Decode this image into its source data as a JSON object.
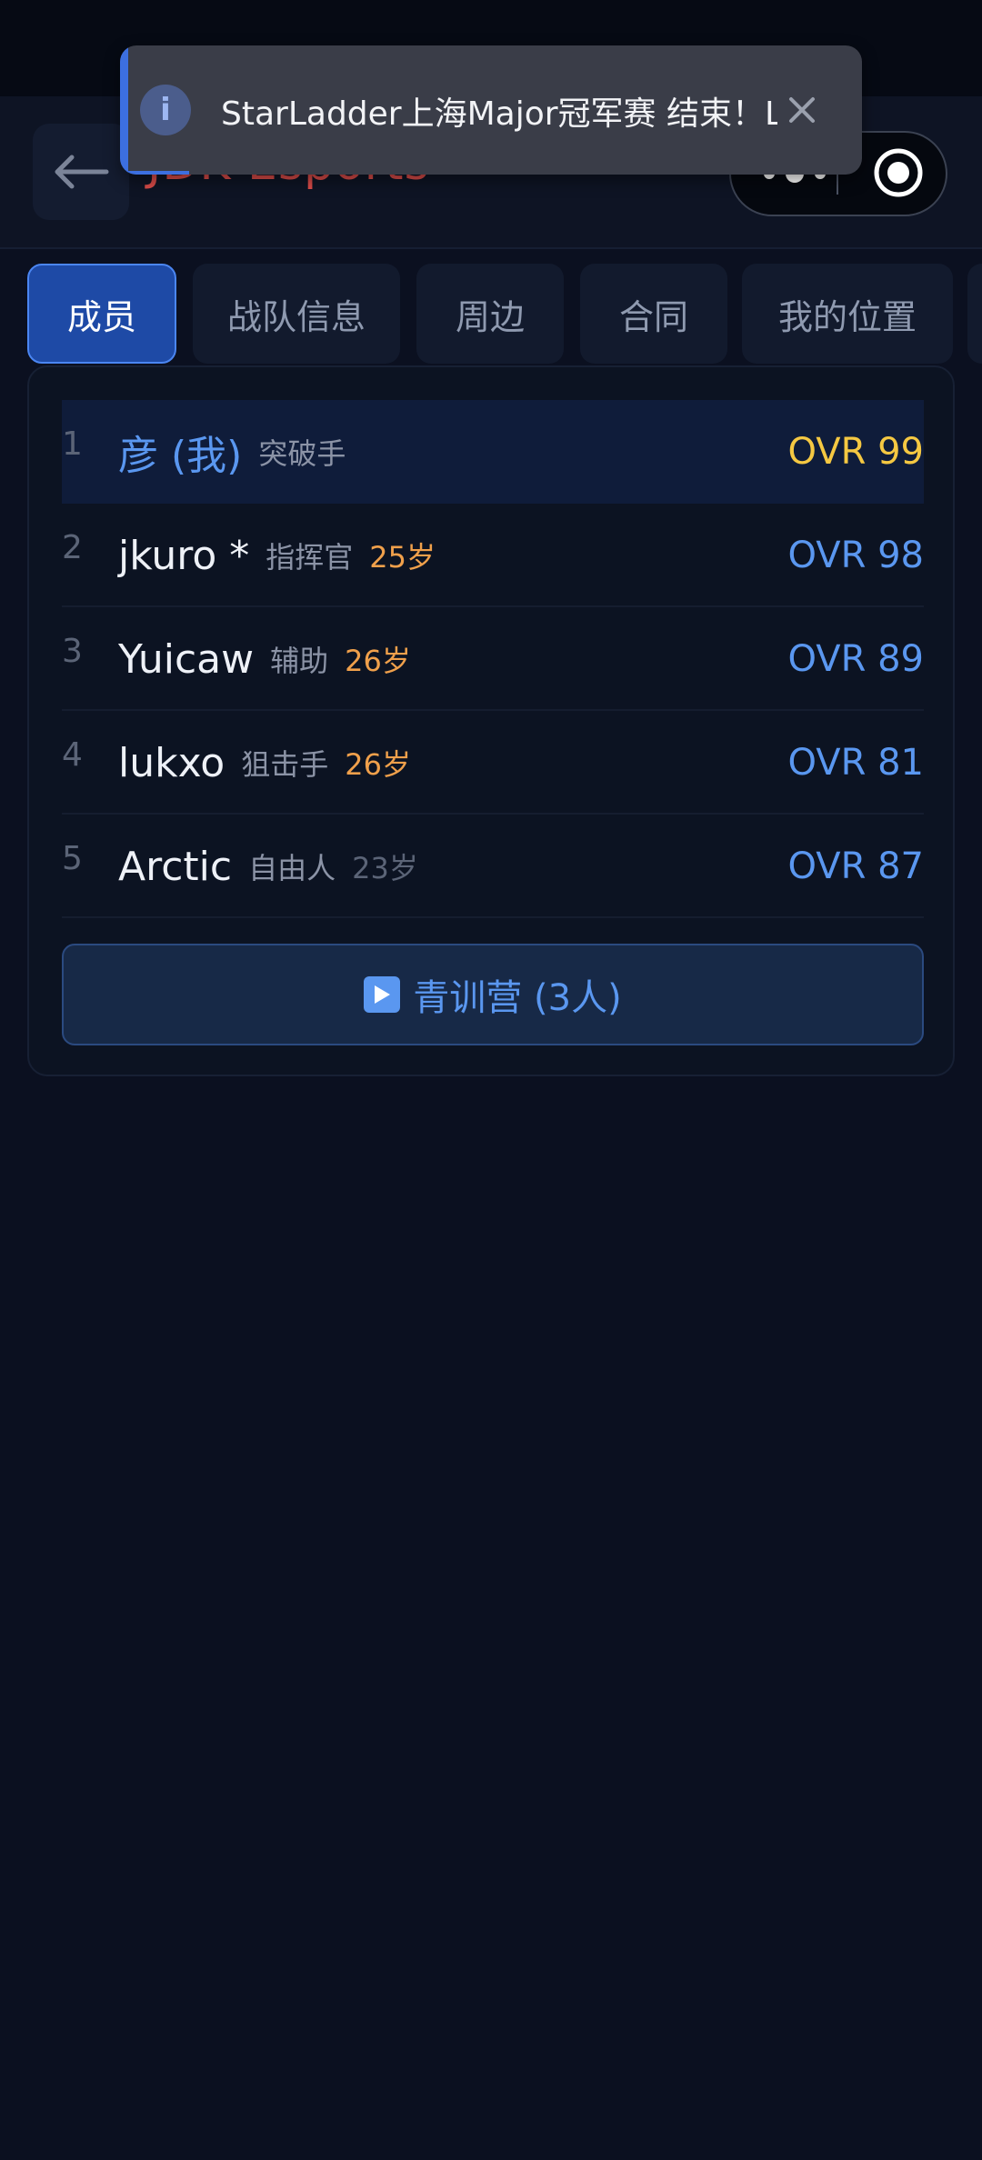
{
  "header": {
    "team_name": "JDK Esports"
  },
  "toast": {
    "message": "StarLadder上海Major冠军赛 结束！L",
    "icon": "info-icon",
    "accent_color": "#3c6fe0"
  },
  "capsule": {
    "more_icon": "more-dots-icon",
    "close_icon": "target-icon"
  },
  "tabs": [
    {
      "label": "成员",
      "active": true
    },
    {
      "label": "战队信息",
      "active": false
    },
    {
      "label": "周边",
      "active": false
    },
    {
      "label": "合同",
      "active": false
    },
    {
      "label": "我的位置",
      "active": false
    }
  ],
  "roster": [
    {
      "rank": "1",
      "name": "彦 (我)",
      "role": "突破手",
      "age": "",
      "ovr": "OVR 99"
    },
    {
      "rank": "2",
      "name": "jkuro *",
      "role": "指挥官",
      "age": "25岁",
      "ovr": "OVR 98"
    },
    {
      "rank": "3",
      "name": "Yuicaw",
      "role": "辅助",
      "age": "26岁",
      "ovr": "OVR 89"
    },
    {
      "rank": "4",
      "name": "lukxo",
      "role": "狙击手",
      "age": "26岁",
      "ovr": "OVR 81"
    },
    {
      "rank": "5",
      "name": "Arctic",
      "role": "自由人",
      "age": "23岁",
      "ovr": "OVR 87"
    }
  ],
  "youth_camp_button": "青训营 (3人)",
  "colors": {
    "accent_blue": "#5a97f0",
    "gold": "#f5c842",
    "age_orange": "#f0a04b",
    "team_red": "#d94b48",
    "background": "#0b1020"
  }
}
